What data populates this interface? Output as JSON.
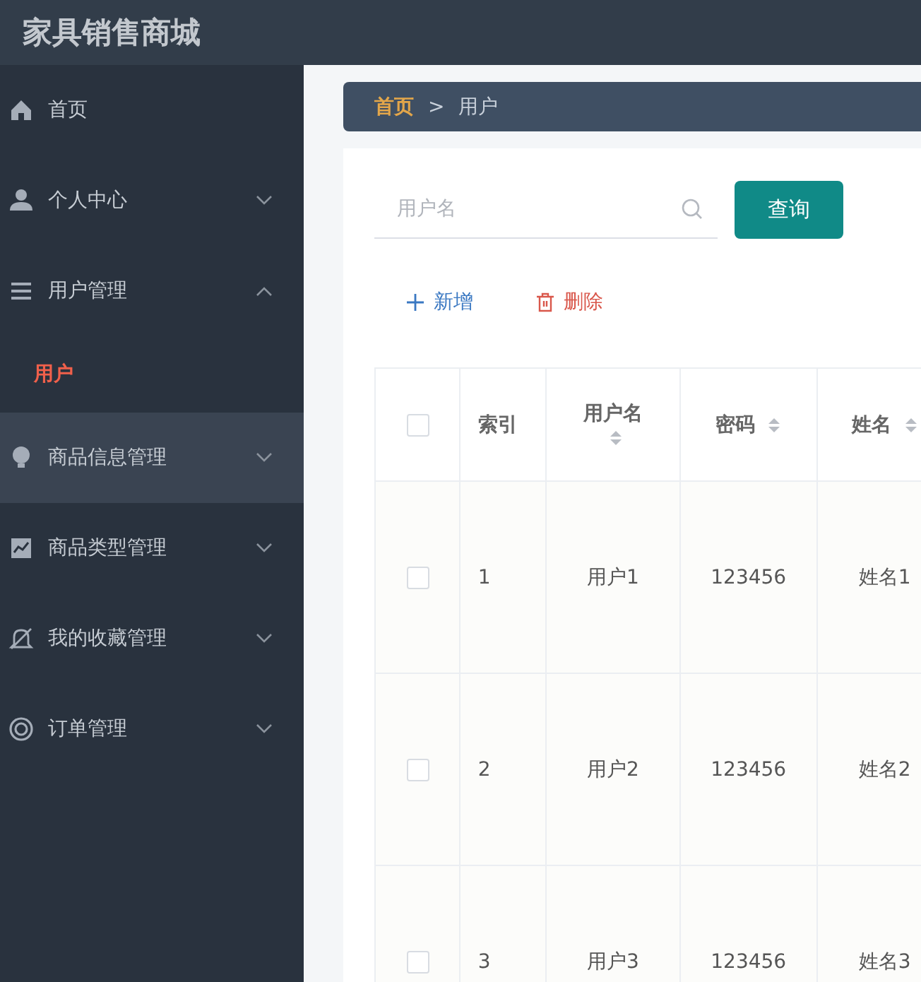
{
  "header": {
    "title": "家具销售商城"
  },
  "sidebar": {
    "items": [
      {
        "kind": "link",
        "label": "首页",
        "hovered": false
      },
      {
        "kind": "menu",
        "label": "个人中心",
        "expanded": false,
        "hovered": false
      },
      {
        "kind": "menu",
        "label": "用户管理",
        "expanded": true,
        "hovered": false,
        "children": [
          {
            "label": "用户",
            "selected": true
          }
        ]
      },
      {
        "kind": "menu",
        "label": "商品信息管理",
        "expanded": false,
        "hovered": true
      },
      {
        "kind": "menu",
        "label": "商品类型管理",
        "expanded": false,
        "hovered": false
      },
      {
        "kind": "menu",
        "label": "我的收藏管理",
        "expanded": false,
        "hovered": false
      },
      {
        "kind": "menu",
        "label": "订单管理",
        "expanded": false,
        "hovered": false
      }
    ]
  },
  "breadcrumb": [
    {
      "label": "首页",
      "current": false
    },
    {
      "label": "用户",
      "current": true
    }
  ],
  "breadcrumb_separator": ">",
  "search": {
    "placeholder": "用户名",
    "button": "查询"
  },
  "actions": [
    {
      "kind": "add",
      "label": "新增"
    },
    {
      "kind": "delete",
      "label": "删除"
    }
  ],
  "table": {
    "columns": [
      {
        "kind": "checkbox",
        "checked": false,
        "sortable": false
      },
      {
        "label": "索引",
        "sortable": false
      },
      {
        "label": "用户名",
        "sortable": true
      },
      {
        "label": "密码",
        "sortable": true
      },
      {
        "label": "姓名",
        "sortable": true
      }
    ],
    "rows": [
      {
        "checked": false,
        "cells": [
          "",
          "1",
          "用户1",
          "123456",
          "姓名1"
        ]
      },
      {
        "checked": false,
        "cells": [
          "",
          "2",
          "用户2",
          "123456",
          "姓名2"
        ]
      },
      {
        "checked": false,
        "cells": [
          "",
          "3",
          "用户3",
          "123456",
          "姓名3"
        ]
      }
    ]
  }
}
